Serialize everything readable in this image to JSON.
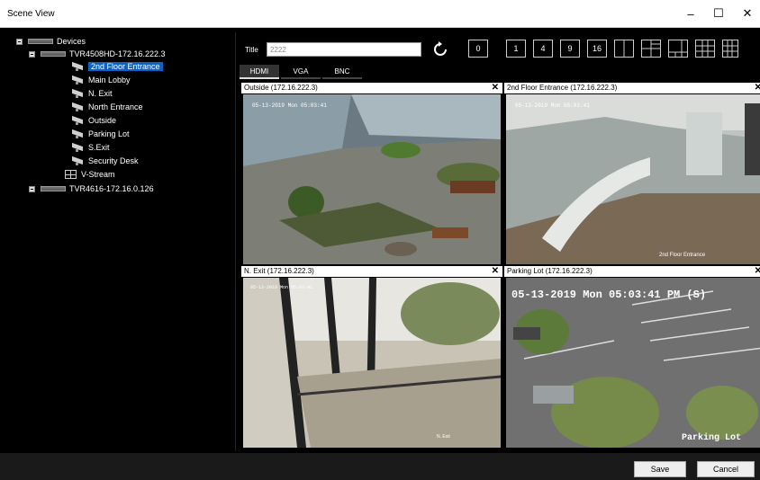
{
  "window": {
    "title": "Scene View",
    "controls": {
      "minimize": "–",
      "maximize": "☐",
      "close": "✕"
    }
  },
  "tree": {
    "root_label": "Devices",
    "device1": {
      "label": "TVR4508HD-172.16.222.3"
    },
    "cameras": [
      {
        "label": "2nd Floor Entrance",
        "selected": true
      },
      {
        "label": "Main Lobby"
      },
      {
        "label": "N. Exit"
      },
      {
        "label": "North Entrance"
      },
      {
        "label": "Outside"
      },
      {
        "label": "Parking Lot"
      },
      {
        "label": "S.Exit"
      },
      {
        "label": "Security Desk"
      }
    ],
    "vstream": {
      "label": "V-Stream"
    },
    "device2": {
      "label": "TVR4616-172.16.0.126"
    }
  },
  "toolbar": {
    "title_label": "Title",
    "title_value": "2222",
    "view_buttons": [
      "0",
      "1",
      "4",
      "9",
      "16"
    ]
  },
  "tabs": [
    {
      "label": "HDMI",
      "active": true
    },
    {
      "label": "VGA"
    },
    {
      "label": "BNC"
    }
  ],
  "cells": [
    {
      "title": "Outside (172.16.222.3)",
      "osd": "05-13-2019 Mon 05:03:41"
    },
    {
      "title": "2nd Floor Entrance (172.16.222.3)",
      "osd": "05-13-2019 Mon 05:03:41",
      "caption": "2nd Floor Entrance"
    },
    {
      "title": "N. Exit (172.16.222.3)",
      "osd": "05-13-2019 Mon 05:03:41",
      "caption": "N. Exit"
    },
    {
      "title": "Parking Lot (172.16.222.3)",
      "osd": "05-13-2019 Mon 05:03:41 PM (S)",
      "caption": "Parking Lot"
    }
  ],
  "footer": {
    "save_label": "Save",
    "cancel_label": "Cancel"
  }
}
